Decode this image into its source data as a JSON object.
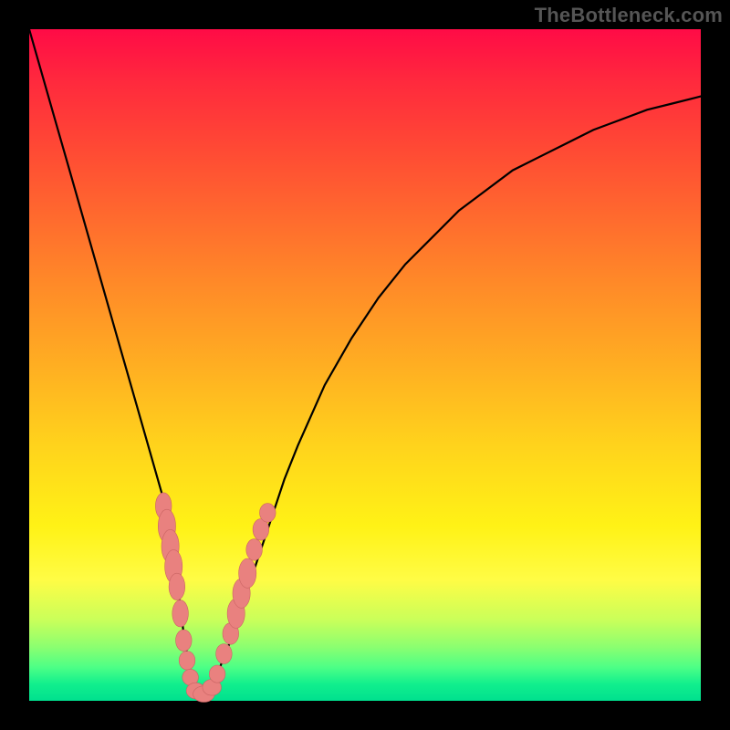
{
  "watermark": "TheBottleneck.com",
  "colors": {
    "curve": "#000000",
    "marker_fill": "#e9817f",
    "marker_stroke": "#ca6463"
  },
  "chart_data": {
    "type": "line",
    "title": "",
    "xlabel": "",
    "ylabel": "",
    "xlim": [
      0,
      100
    ],
    "ylim": [
      0,
      100
    ],
    "grid": false,
    "series": [
      {
        "name": "bottleneck-curve",
        "x": [
          0,
          2,
          4,
          6,
          8,
          10,
          12,
          14,
          16,
          18,
          20,
          22,
          23,
          24,
          25,
          26,
          28,
          30,
          32,
          34,
          36,
          38,
          40,
          44,
          48,
          52,
          56,
          60,
          64,
          68,
          72,
          76,
          80,
          84,
          88,
          92,
          96,
          100
        ],
        "y": [
          100,
          93,
          86,
          79,
          72,
          65,
          58,
          51,
          44,
          37,
          30,
          18,
          10,
          4,
          1,
          1,
          4,
          9,
          15,
          21,
          27,
          33,
          38,
          47,
          54,
          60,
          65,
          69,
          73,
          76,
          79,
          81,
          83,
          85,
          86.5,
          88,
          89,
          90
        ]
      }
    ],
    "markers": {
      "name": "sample-points",
      "points": [
        {
          "x": 20.0,
          "y": 29.0,
          "rx": 1.2,
          "ry": 2.0
        },
        {
          "x": 20.5,
          "y": 26.0,
          "rx": 1.3,
          "ry": 2.5
        },
        {
          "x": 21.0,
          "y": 23.0,
          "rx": 1.3,
          "ry": 2.5
        },
        {
          "x": 21.5,
          "y": 20.0,
          "rx": 1.3,
          "ry": 2.5
        },
        {
          "x": 22.0,
          "y": 17.0,
          "rx": 1.2,
          "ry": 2.0
        },
        {
          "x": 22.5,
          "y": 13.0,
          "rx": 1.2,
          "ry": 2.0
        },
        {
          "x": 23.0,
          "y": 9.0,
          "rx": 1.2,
          "ry": 1.6
        },
        {
          "x": 23.5,
          "y": 6.0,
          "rx": 1.2,
          "ry": 1.4
        },
        {
          "x": 24.0,
          "y": 3.5,
          "rx": 1.2,
          "ry": 1.2
        },
        {
          "x": 24.8,
          "y": 1.5,
          "rx": 1.4,
          "ry": 1.2
        },
        {
          "x": 26.0,
          "y": 1.0,
          "rx": 1.6,
          "ry": 1.2
        },
        {
          "x": 27.2,
          "y": 2.0,
          "rx": 1.4,
          "ry": 1.2
        },
        {
          "x": 28.0,
          "y": 4.0,
          "rx": 1.2,
          "ry": 1.3
        },
        {
          "x": 29.0,
          "y": 7.0,
          "rx": 1.2,
          "ry": 1.5
        },
        {
          "x": 30.0,
          "y": 10.0,
          "rx": 1.2,
          "ry": 1.6
        },
        {
          "x": 30.8,
          "y": 13.0,
          "rx": 1.3,
          "ry": 2.2
        },
        {
          "x": 31.6,
          "y": 16.0,
          "rx": 1.3,
          "ry": 2.2
        },
        {
          "x": 32.5,
          "y": 19.0,
          "rx": 1.3,
          "ry": 2.2
        },
        {
          "x": 33.5,
          "y": 22.5,
          "rx": 1.2,
          "ry": 1.6
        },
        {
          "x": 34.5,
          "y": 25.5,
          "rx": 1.2,
          "ry": 1.6
        },
        {
          "x": 35.5,
          "y": 28.0,
          "rx": 1.2,
          "ry": 1.4
        }
      ]
    }
  }
}
